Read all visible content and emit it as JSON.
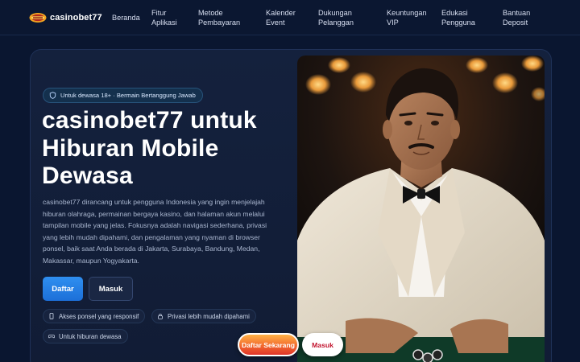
{
  "brand": {
    "name": "casinobet77",
    "logo_icon": "casino-logo-icon"
  },
  "nav": [
    {
      "label": "Beranda"
    },
    {
      "label": "Fitur\nAplikasi"
    },
    {
      "label": "Metode\nPembayaran"
    },
    {
      "label": "Kalender\nEvent"
    },
    {
      "label": "Dukungan\nPelanggan"
    },
    {
      "label": "Keuntungan\nVIP"
    },
    {
      "label": "Edukasi\nPengguna"
    },
    {
      "label": "Bantuan\nDeposit"
    }
  ],
  "hero": {
    "badge": "Untuk dewasa 18+ · Bermain Bertanggung Jawab",
    "title": "casinobet77 untuk Hiburan Mobile Dewasa",
    "description": "casinobet77 dirancang untuk pengguna Indonesia yang ingin menjelajah hiburan olahraga, permainan bergaya kasino, dan halaman akun melalui tampilan mobile yang jelas. Fokusnya adalah navigasi sederhana, privasi yang lebih mudah dipahami, dan pengalaman yang nyaman di browser ponsel, baik saat Anda berada di Jakarta, Surabaya, Bandung, Medan, Makassar, maupun Yogyakarta.",
    "primary_button": "Daftar",
    "secondary_button": "Masuk",
    "features": [
      {
        "label": "Akses ponsel yang responsif",
        "icon": "phone-icon"
      },
      {
        "label": "Privasi lebih mudah dipahami",
        "icon": "lock-icon"
      },
      {
        "label": "Untuk hiburan dewasa",
        "icon": "gamepad-icon"
      }
    ]
  },
  "floating": {
    "register_label": "Daftar Sekarang",
    "login_label": "Masuk"
  },
  "colors": {
    "background": "#0a1630",
    "card": "#14213d",
    "primary_blue": "#2f8ff0",
    "cta_orange": "#f26a2e",
    "cta_red_text": "#c2142e"
  }
}
